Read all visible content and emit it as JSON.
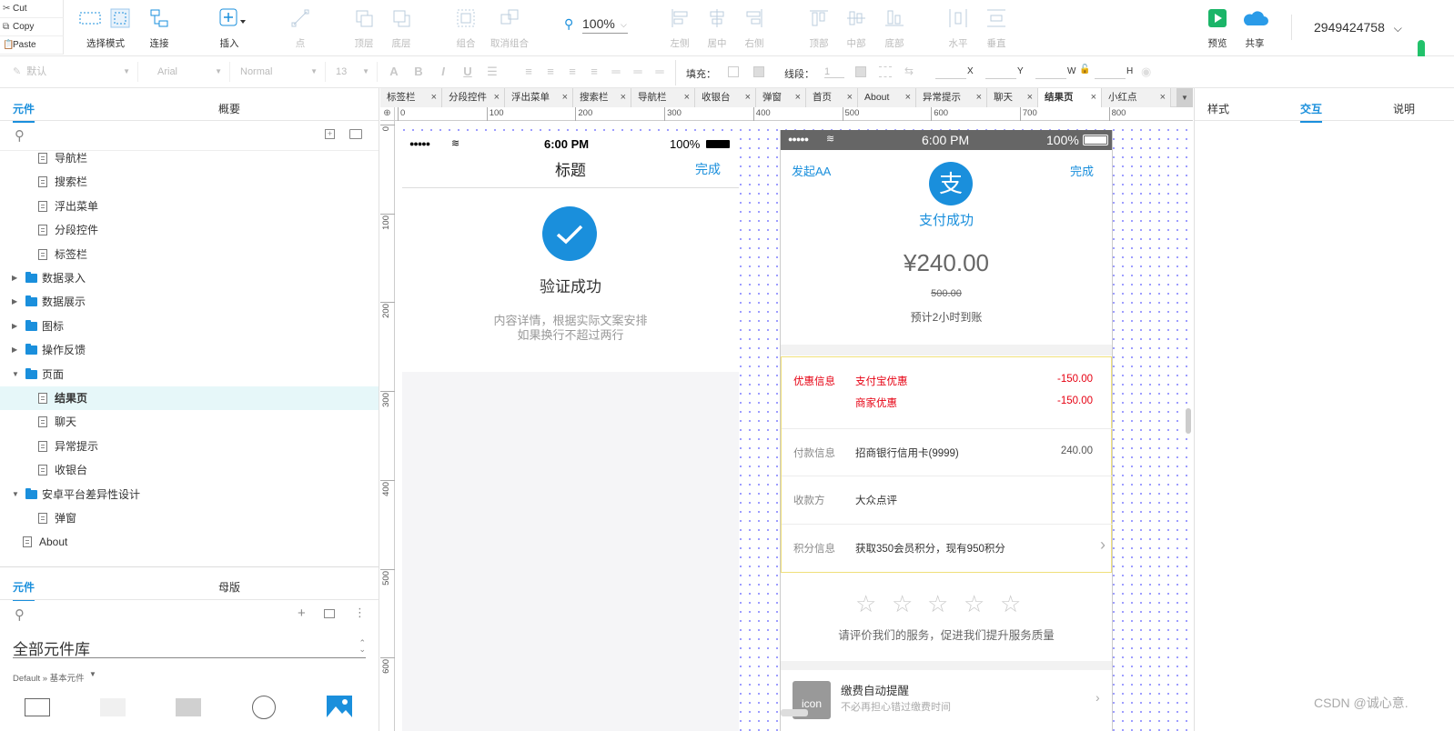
{
  "clipboard": {
    "cut": "Cut",
    "copy": "Copy",
    "paste": "Paste"
  },
  "toolbar": {
    "select_mode": "选择模式",
    "connect": "连接",
    "insert": "插入",
    "point": "点",
    "top_layer": "顶层",
    "bottom_layer": "底层",
    "group": "组合",
    "ungroup": "取消组合",
    "zoom": "100%",
    "align_left": "左侧",
    "align_center": "居中",
    "align_right": "右侧",
    "align_top": "顶部",
    "align_middle": "中部",
    "align_bottom": "底部",
    "distribute_h": "水平",
    "distribute_v": "垂直",
    "preview": "预览",
    "share": "共享",
    "account": "2949424758"
  },
  "format": {
    "style": "默认",
    "font": "Arial",
    "weight": "Normal",
    "size": "13",
    "fill_label": "填充：",
    "line_label": "线段：",
    "line_width": "1",
    "x": "X",
    "y": "Y",
    "w": "W",
    "h": "H"
  },
  "left": {
    "tab_widgets": "元件",
    "tab_outline": "概要",
    "tree": [
      {
        "label": "导航栏",
        "type": "page",
        "indent": 1
      },
      {
        "label": "搜索栏",
        "type": "page",
        "indent": 1
      },
      {
        "label": "浮出菜单",
        "type": "page",
        "indent": 1
      },
      {
        "label": "分段控件",
        "type": "page",
        "indent": 1
      },
      {
        "label": "标签栏",
        "type": "page",
        "indent": 1
      },
      {
        "label": "数据录入",
        "type": "folder",
        "indent": 0,
        "state": "closed"
      },
      {
        "label": "数据展示",
        "type": "folder",
        "indent": 0,
        "state": "closed"
      },
      {
        "label": "图标",
        "type": "folder",
        "indent": 0,
        "state": "closed"
      },
      {
        "label": "操作反馈",
        "type": "folder",
        "indent": 0,
        "state": "closed"
      },
      {
        "label": "页面",
        "type": "folder",
        "indent": 0,
        "state": "open"
      },
      {
        "label": "结果页",
        "type": "page",
        "indent": 1,
        "selected": true
      },
      {
        "label": "聊天",
        "type": "page",
        "indent": 1
      },
      {
        "label": "异常提示",
        "type": "page",
        "indent": 1
      },
      {
        "label": "收银台",
        "type": "page",
        "indent": 1
      },
      {
        "label": "安卓平台差异性设计",
        "type": "folder",
        "indent": 0,
        "state": "open"
      },
      {
        "label": "弹窗",
        "type": "page",
        "indent": 1
      },
      {
        "label": "About",
        "type": "page",
        "indent": 0
      }
    ],
    "lib_tab_widgets": "元件",
    "lib_tab_masters": "母版",
    "library_name": "全部元件库",
    "library_path": "Default » 基本元件"
  },
  "tabs": [
    "标签栏",
    "分段控件",
    "浮出菜单",
    "搜索栏",
    "导航栏",
    "收银台",
    "弹窗",
    "首页",
    "About",
    "异常提示",
    "聊天",
    "结果页",
    "小红点"
  ],
  "active_tab": "结果页",
  "ruler": {
    "h": [
      "0",
      "100",
      "200",
      "300",
      "400",
      "500",
      "600",
      "700",
      "800"
    ],
    "v": [
      "0",
      "100",
      "200",
      "300",
      "400",
      "500",
      "600"
    ]
  },
  "phone1": {
    "signal": "●●●●●",
    "time": "6:00 PM",
    "battery": "100%",
    "title": "标题",
    "done": "完成",
    "result": "验证成功",
    "desc1": "内容详情，根据实际文案安排",
    "desc2": "如果换行不超过两行"
  },
  "phone2": {
    "signal": "●●●●●",
    "time": "6:00 PM",
    "battery": "100%",
    "left_action": "发起AA",
    "done": "完成",
    "logo_char": "支",
    "status": "支付成功",
    "amount": "¥240.00",
    "original": "500.00",
    "eta": "预计2小时到账",
    "rows": [
      {
        "label": "优惠信息",
        "items": [
          {
            "name": "支付宝优惠",
            "value": "-150.00"
          },
          {
            "name": "商家优惠",
            "value": "-150.00"
          }
        ],
        "highlight": true
      },
      {
        "label": "付款信息",
        "items": [
          {
            "name": "招商银行信用卡(9999)",
            "value": "240.00"
          }
        ]
      },
      {
        "label": "收款方",
        "items": [
          {
            "name": "大众点评",
            "value": ""
          }
        ]
      },
      {
        "label": "积分信息",
        "items": [
          {
            "name": "获取350会员积分，现有950积分",
            "value": ""
          }
        ],
        "arrow": true
      }
    ],
    "rating_hint": "请评价我们的服务，促进我们提升服务质量",
    "notice_icon": "icon",
    "notice_title": "缴费自动提醒",
    "notice_sub": "不必再担心错过缴费时间"
  },
  "right": {
    "tab_style": "样式",
    "tab_interact": "交互",
    "tab_notes": "说明"
  },
  "watermark": "CSDN @诚心意."
}
